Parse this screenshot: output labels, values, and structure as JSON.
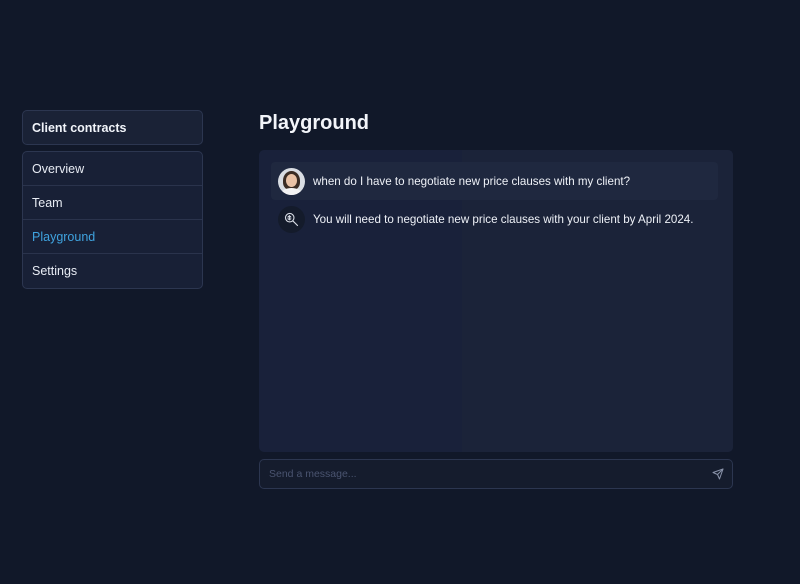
{
  "sidebar": {
    "project_title": "Client contracts",
    "items": [
      {
        "label": "Overview"
      },
      {
        "label": "Team"
      },
      {
        "label": "Playground"
      },
      {
        "label": "Settings"
      }
    ],
    "active_item": "Playground"
  },
  "main": {
    "title": "Playground",
    "messages": [
      {
        "role": "user",
        "avatar": "user-photo",
        "text": "when do I have to negotiate new price clauses with my client?"
      },
      {
        "role": "assistant",
        "avatar": "ai-brain-icon",
        "text": "You will need to negotiate new price clauses with your client by April 2024."
      }
    ],
    "composer": {
      "placeholder": "Send a message...",
      "value": "",
      "send_icon": "send-icon"
    }
  },
  "colors": {
    "background": "#111829",
    "panel": "#19213a",
    "active_nav": "#3fa3df",
    "border": "#2c3650"
  }
}
